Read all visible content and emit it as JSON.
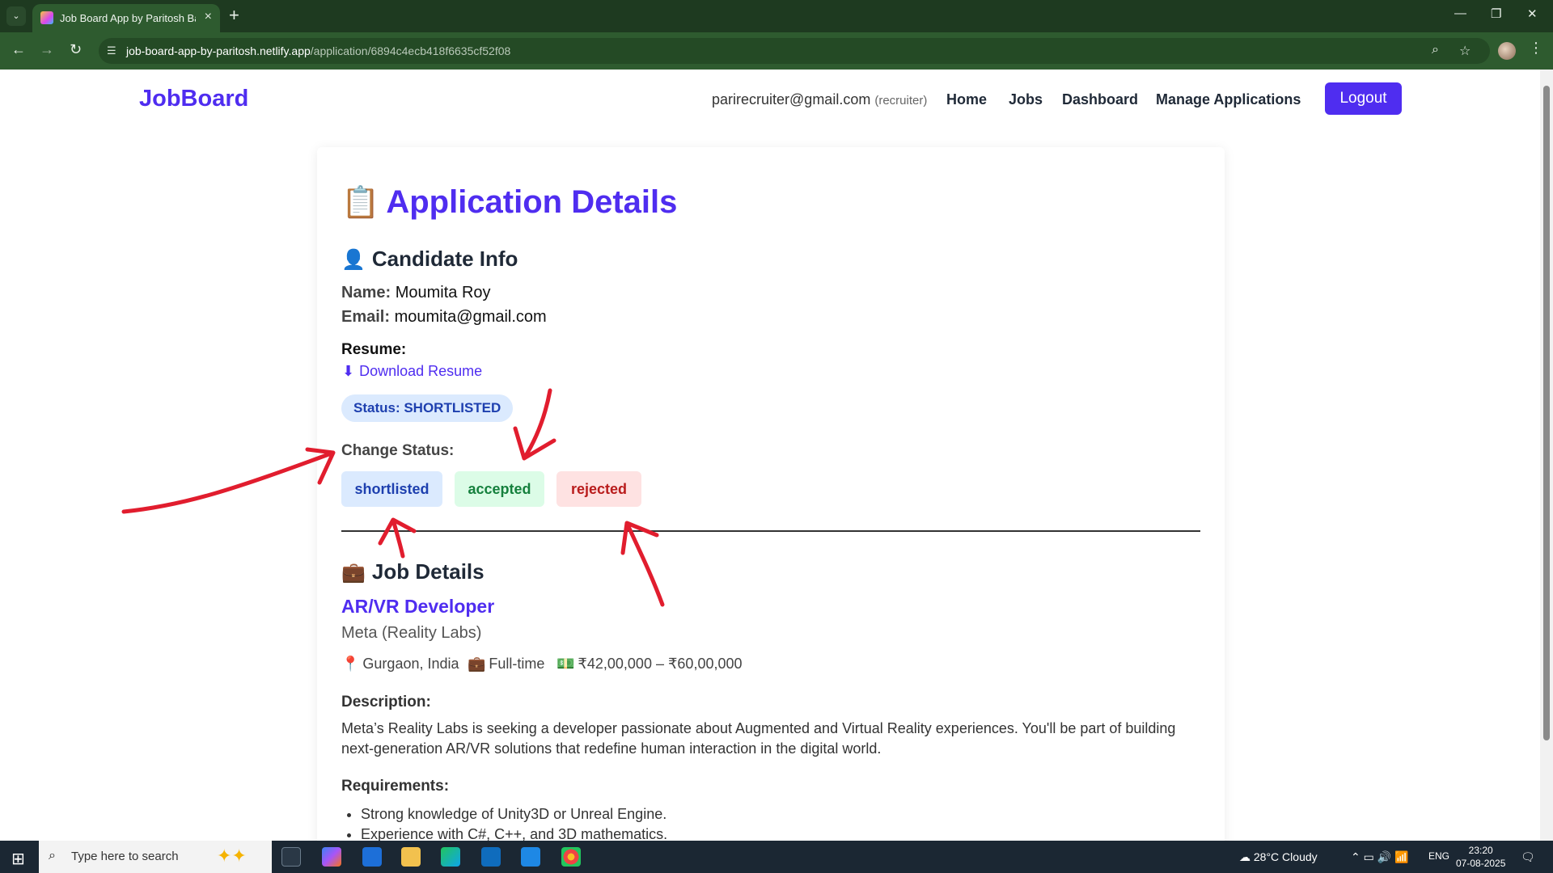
{
  "browser": {
    "tab_title": "Job Board App by Paritosh Barman",
    "url_domain": "job-board-app-by-paritosh.netlify.app",
    "url_path": "/application/6894c4ecb418f6635cf52f08"
  },
  "navbar": {
    "brand": "JobBoard",
    "user_email": "parirecruiter@gmail.com",
    "user_role": "(recruiter)",
    "links": [
      "Home",
      "Jobs",
      "Dashboard",
      "Manage Applications"
    ],
    "logout": "Logout"
  },
  "page": {
    "title": "Application Details",
    "title_icon": "clipboard-icon"
  },
  "candidate": {
    "heading": "Candidate Info",
    "name_label": "Name:",
    "name": "Moumita Roy",
    "email_label": "Email:",
    "email": "moumita@gmail.com",
    "resume_label": "Resume:",
    "resume_link": "Download Resume",
    "status_badge": "Status: SHORTLISTED"
  },
  "status_change": {
    "label": "Change Status:",
    "options": [
      "shortlisted",
      "accepted",
      "rejected"
    ]
  },
  "job": {
    "heading": "Job Details",
    "title": "AR/VR Developer",
    "company": "Meta (Reality Labs)",
    "location": "Gurgaon, India",
    "type": "Full-time",
    "salary": "₹42,00,000 – ₹60,00,000",
    "description_label": "Description:",
    "description": "Meta’s Reality Labs is seeking a developer passionate about Augmented and Virtual Reality experiences. You'll be part of building next-generation AR/VR solutions that redefine human interaction in the digital world.",
    "requirements_label": "Requirements:",
    "requirements": [
      "Strong knowledge of Unity3D or Unreal Engine.",
      "Experience with C#, C++, and 3D mathematics."
    ]
  },
  "taskbar": {
    "search_placeholder": "Type here to search",
    "weather": "28°C  Cloudy",
    "language": "ENG",
    "time": "23:20",
    "date": "07-08-2025"
  },
  "colors": {
    "brand": "#4f2df0",
    "annotation": "#e11d2e"
  }
}
